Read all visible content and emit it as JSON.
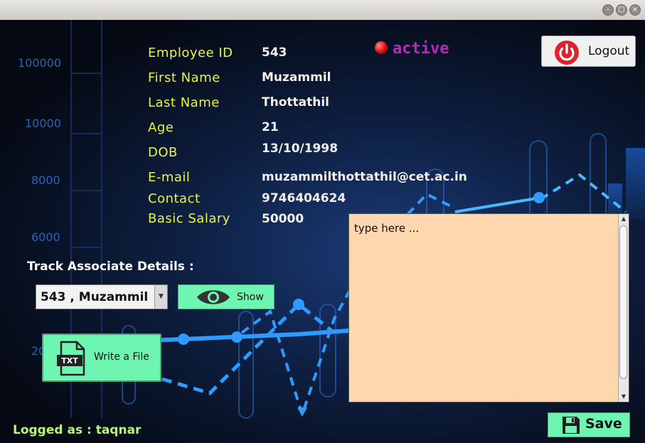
{
  "window": {
    "controls": [
      "minimize",
      "maximize",
      "close"
    ]
  },
  "background": {
    "axis_ticks": [
      "100000",
      "10000",
      "8000",
      "6000",
      "20"
    ]
  },
  "employee": {
    "fields": [
      {
        "label": "Employee ID",
        "value": "543"
      },
      {
        "label": "First Name",
        "value": "Muzammil"
      },
      {
        "label": "Last Name",
        "value": "Thottathil"
      },
      {
        "label": "Age",
        "value": "21"
      },
      {
        "label": "DOB",
        "value": "13/10/1998"
      },
      {
        "label": "E-mail",
        "value": "muzammilthottathil@cet.ac.in"
      },
      {
        "label": "Contact",
        "value": "9746404624"
      },
      {
        "label": "Basic Salary",
        "value": "50000"
      }
    ],
    "status": "active",
    "status_color": "#b52bb8"
  },
  "logout": {
    "label": "Logout",
    "icon": "power-icon"
  },
  "track": {
    "label": "Track Associate Details :",
    "selected": "543 , Muzammil",
    "show_label": "Show",
    "show_icon": "eye-icon"
  },
  "write_file": {
    "label": "Write a File",
    "icon": "txt-file-icon",
    "icon_text": "TXT"
  },
  "notes": {
    "placeholder": "type here ..."
  },
  "save": {
    "label": "Save",
    "icon": "floppy-disk-icon"
  },
  "footer": {
    "logged_as_label": "Logged as  :",
    "user": "taqnar"
  },
  "colors": {
    "label_text": "#e6f542",
    "button_bg": "#6ff5b2",
    "notes_bg": "#ffd7ae",
    "footer_text": "#b7f57a"
  }
}
